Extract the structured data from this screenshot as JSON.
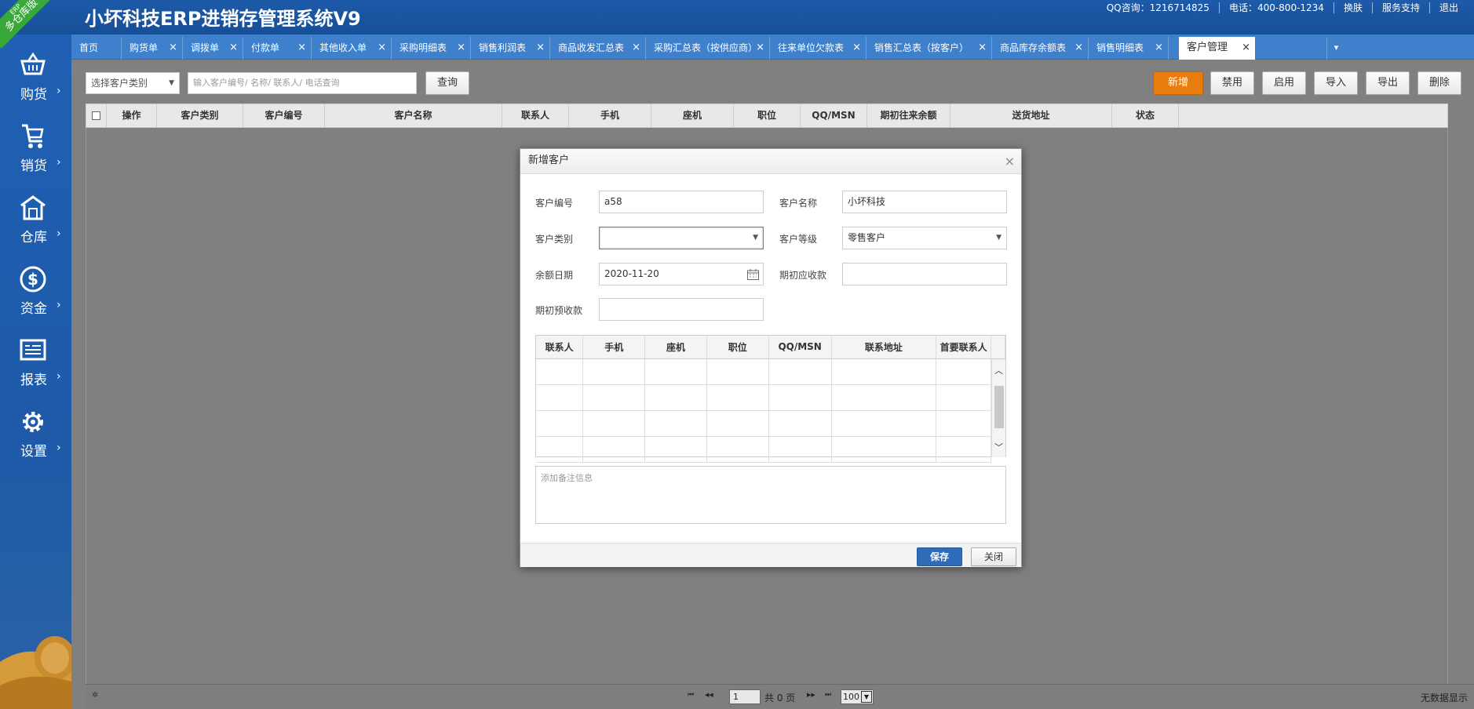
{
  "app": {
    "title": "小坏科技ERP进销存管理系统V9",
    "ribbon_small": "ERP",
    "ribbon_text": "多仓库版",
    "top_links": [
      "QQ咨询：1216714825",
      "电话：400-800-1234",
      "换肤",
      "服务支持",
      "退出"
    ]
  },
  "sidebar": {
    "items": [
      {
        "label": "购货",
        "arrow": "›",
        "icon": "basket-icon"
      },
      {
        "label": "销货",
        "arrow": "›",
        "icon": "cart-icon"
      },
      {
        "label": "仓库",
        "arrow": "›",
        "icon": "warehouse-icon"
      },
      {
        "label": "资金",
        "arrow": "›",
        "icon": "dollar-icon"
      },
      {
        "label": "报表",
        "arrow": "›",
        "icon": "report-icon"
      },
      {
        "label": "设置",
        "arrow": "›",
        "icon": "gear-icon"
      }
    ]
  },
  "tabs": {
    "items": [
      {
        "label": "首页",
        "close": ""
      },
      {
        "label": "购货单",
        "close": "×"
      },
      {
        "label": "调拨单",
        "close": "×"
      },
      {
        "label": "付款单",
        "close": "×"
      },
      {
        "label": "其他收入单",
        "close": "×"
      },
      {
        "label": "采购明细表",
        "close": "×"
      },
      {
        "label": "销售利润表",
        "close": "×"
      },
      {
        "label": "商品收发汇总表",
        "close": "×"
      },
      {
        "label": "采购汇总表（按供应商）",
        "close": "×"
      },
      {
        "label": "往来单位欠款表",
        "close": "×"
      },
      {
        "label": "销售汇总表（按客户）",
        "close": "×"
      },
      {
        "label": "商品库存余额表",
        "close": "×"
      },
      {
        "label": "销售明细表",
        "close": "×"
      },
      {
        "label": "客户管理",
        "close": "×"
      }
    ],
    "more": "▾"
  },
  "toolbar": {
    "category_select": "选择客户类别",
    "search_placeholder": "输入客户编号/ 名称/ 联系人/ 电话查询",
    "query_button": "查询",
    "add_button": "新增",
    "disable_button": "禁用",
    "enable_button": "启用",
    "import_button": "导入",
    "export_button": "导出",
    "delete_button": "删除"
  },
  "grid": {
    "columns": [
      "操作",
      "客户类别",
      "客户编号",
      "客户名称",
      "联系人",
      "手机",
      "座机",
      "职位",
      "QQ/MSN",
      "期初往来余额",
      "送货地址",
      "状态"
    ]
  },
  "pager": {
    "page": "1",
    "total": "共 0 页",
    "page_size": "100",
    "empty_text": "无数据显示",
    "first": "⏮",
    "prev": "◀◀",
    "next": "▶▶",
    "last": "⏭"
  },
  "modal": {
    "title": "新增客户",
    "close": "×",
    "fields": {
      "code_label": "客户编号",
      "code_value": "a58",
      "name_label": "客户名称",
      "name_value": "小坏科技",
      "category_label": "客户类别",
      "category_value": "",
      "level_label": "客户等级",
      "level_value": "零售客户",
      "balance_date_label": "余额日期",
      "balance_date_value": "2020-11-20",
      "init_receivable_label": "期初应收款",
      "init_receivable_value": "",
      "init_prepaid_label": "期初预收款",
      "init_prepaid_value": ""
    },
    "contact_columns": [
      "联系人",
      "手机",
      "座机",
      "职位",
      "QQ/MSN",
      "联系地址",
      "首要联系人"
    ],
    "remark_placeholder": "添加备注信息",
    "save_button": "保存",
    "close_button": "关闭"
  }
}
